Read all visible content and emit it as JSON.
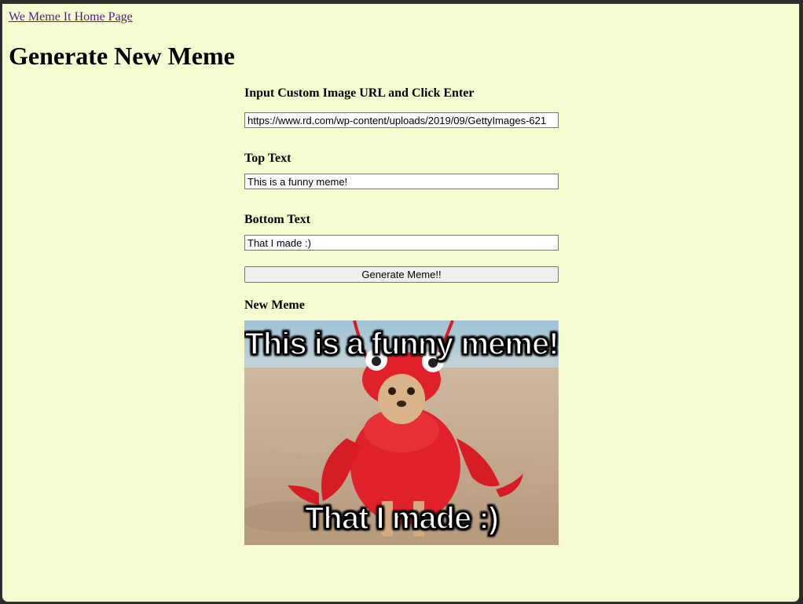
{
  "nav": {
    "home_link": "We Meme It Home Page"
  },
  "page": {
    "title": "Generate New Meme"
  },
  "form": {
    "image_url_label": "Input Custom Image URL and Click Enter",
    "image_url_value": "https://www.rd.com/wp-content/uploads/2019/09/GettyImages-621",
    "top_text_label": "Top Text",
    "top_text_value": "This is a funny meme!",
    "bottom_text_label": "Bottom Text",
    "bottom_text_value": "That I made :)",
    "generate_button": "Generate Meme!!"
  },
  "result": {
    "label": "New Meme",
    "top_text": "This is a funny meme!",
    "bottom_text": "That I made :)"
  },
  "colors": {
    "page_background": "#f5fdd0",
    "link": "#551a8b",
    "costume_red": "#e0202a"
  }
}
